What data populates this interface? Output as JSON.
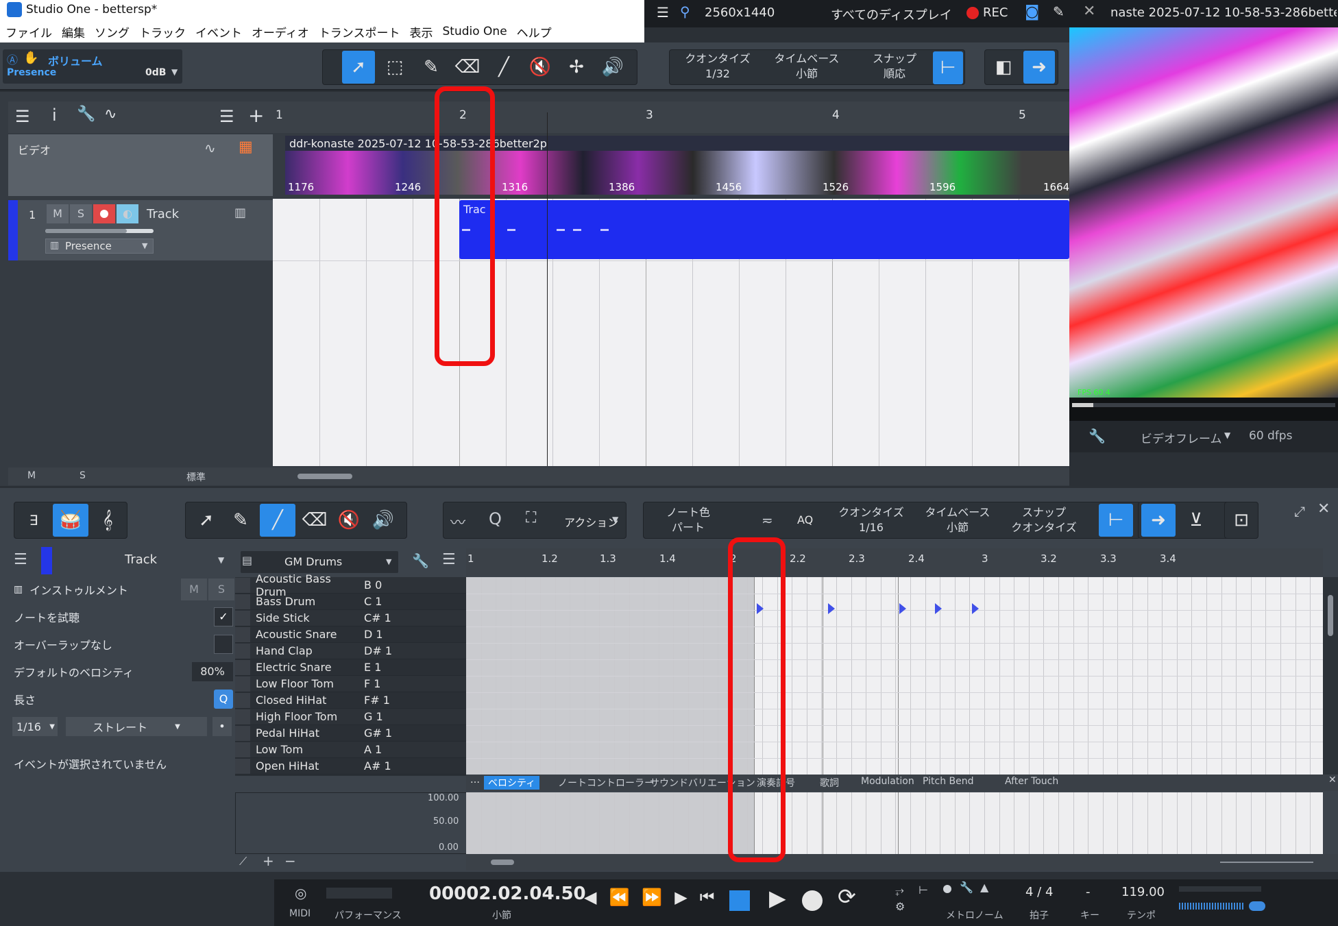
{
  "window": {
    "title": "Studio One - bettersp*"
  },
  "recorder": {
    "resolution": "2560x1440",
    "display": "すべてのディスプレイ",
    "rec_label": "REC",
    "filename": "naste 2025-07-12 10-58-53-286better"
  },
  "menu": [
    "ファイル",
    "編集",
    "ソング",
    "トラック",
    "イベント",
    "オーディオ",
    "トランスポート",
    "表示",
    "Studio One",
    "ヘルプ"
  ],
  "volume": {
    "label": "ボリューム",
    "preset": "Presence",
    "value": "0dB"
  },
  "top_toolbar": {
    "quantize_label": "クオンタイズ",
    "quantize_value": "1/32",
    "timebase_label": "タイムベース",
    "timebase_value": "小節",
    "snap_label": "スナップ",
    "snap_value": "順応"
  },
  "arrange": {
    "ruler": [
      "1",
      "2",
      "3",
      "4",
      "5"
    ],
    "video_track_label": "ビデオ",
    "video_clip_title": "ddr-konaste 2025-07-12 10-58-53-286better2p",
    "video_frame_numbers": [
      "1176",
      "1246",
      "1316",
      "1386",
      "1456",
      "1526",
      "1596",
      "1664"
    ],
    "track_number": "1",
    "track_name": "Track",
    "track_m": "M",
    "track_s": "S",
    "instrument": "Presence",
    "clip_label": "Trac",
    "footer_m": "M",
    "footer_s": "S",
    "footer_mode": "標準"
  },
  "preview": {
    "fps_overlay": "FPS 60.4",
    "video_frame_label": "ビデオフレーム",
    "fps": "60 dfps"
  },
  "editor": {
    "action_label": "アクション",
    "note_color_label": "ノート色",
    "note_color_value": "パート",
    "aq_label": "AQ",
    "quantize_label": "クオンタイズ",
    "quantize_value": "1/16",
    "timebase_label": "タイムベース",
    "timebase_value": "小節",
    "snap_label": "スナップ",
    "snap_value": "クオンタイズ",
    "track_select": "Track",
    "drum_map": "GM Drums",
    "ruler": [
      "1",
      "1.2",
      "1.3",
      "1.4",
      "2",
      "2.2",
      "2.3",
      "2.4",
      "3",
      "3.2",
      "3.3",
      "3.4"
    ]
  },
  "inspector": {
    "instrument_label": "インストゥルメント",
    "m": "M",
    "s": "S",
    "audition_label": "ノートを試聴",
    "no_overlap_label": "オーバーラップなし",
    "default_velocity_label": "デフォルトのベロシティ",
    "default_velocity_value": "80%",
    "length_label": "長さ",
    "length_value": "1/16",
    "length_mode": "ストレート",
    "no_event": "イベントが選択されていません"
  },
  "drums": [
    {
      "name": "Acoustic Bass Drum",
      "note": "B 0"
    },
    {
      "name": "Bass Drum",
      "note": "C 1"
    },
    {
      "name": "Side Stick",
      "note": "C# 1"
    },
    {
      "name": "Acoustic Snare",
      "note": "D 1"
    },
    {
      "name": "Hand Clap",
      "note": "D# 1"
    },
    {
      "name": "Electric Snare",
      "note": "E 1"
    },
    {
      "name": "Low Floor Tom",
      "note": "F 1"
    },
    {
      "name": "Closed HiHat",
      "note": "F# 1"
    },
    {
      "name": "High Floor Tom",
      "note": "G 1"
    },
    {
      "name": "Pedal HiHat",
      "note": "G# 1"
    },
    {
      "name": "Low Tom",
      "note": "A 1"
    },
    {
      "name": "Open HiHat",
      "note": "A# 1"
    }
  ],
  "controller_tabs": [
    "ベロシティ",
    "ノートコントローラー",
    "サウンドバリエーション",
    "演奏記号",
    "歌詞",
    "Modulation",
    "Pitch Bend",
    "After Touch"
  ],
  "velocity_scale": [
    "100.00",
    "50.00",
    "0.00"
  ],
  "transport": {
    "midi_label": "MIDI",
    "performance_label": "パフォーマンス",
    "position": "00002.02.04.50",
    "position_unit": "小節",
    "metronome_label": "メトロノーム",
    "time_sig": "4 / 4",
    "time_sig_label": "拍子",
    "key": "-",
    "key_label": "キー",
    "tempo": "119.00",
    "tempo_label": "テンポ"
  }
}
